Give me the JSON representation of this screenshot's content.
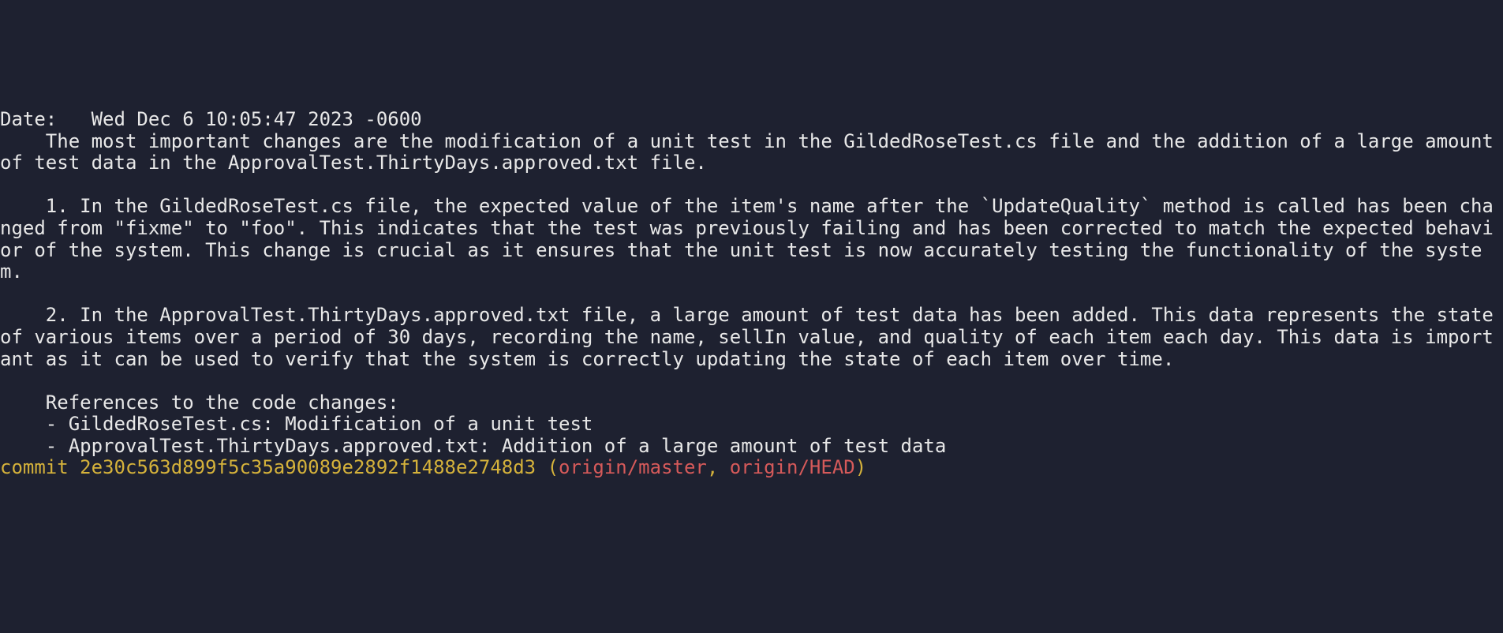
{
  "date_label": "Date:   ",
  "date_value": "Wed Dec 6 10:05:47 2023 -0600",
  "body_block": "\n    The most important changes are the modification of a unit test in the GildedRoseTest.cs file and the addition of a large amount of test data in the ApprovalTest.ThirtyDays.approved.txt file.\n\n    1. In the GildedRoseTest.cs file, the expected value of the item's name after the `UpdateQuality` method is called has been changed from \"fixme\" to \"foo\". This indicates that the test was previously failing and has been corrected to match the expected behavior of the system. This change is crucial as it ensures that the unit test is now accurately testing the functionality of the system.\n\n    2. In the ApprovalTest.ThirtyDays.approved.txt file, a large amount of test data has been added. This data represents the state of various items over a period of 30 days, recording the name, sellIn value, and quality of each item each day. This data is important as it can be used to verify that the system is correctly updating the state of each item over time.\n\n    References to the code changes:\n    - GildedRoseTest.cs: Modification of a unit test\n    - ApprovalTest.ThirtyDays.approved.txt: Addition of a large amount of test data\n",
  "commit_label": "commit ",
  "commit_hash": "2e30c563d899f5c35a90089e2892f1488e2748d3",
  "open_paren": " (",
  "ref1": "origin/master",
  "comma": ", ",
  "ref2": "origin/HEAD",
  "close_paren": ")"
}
